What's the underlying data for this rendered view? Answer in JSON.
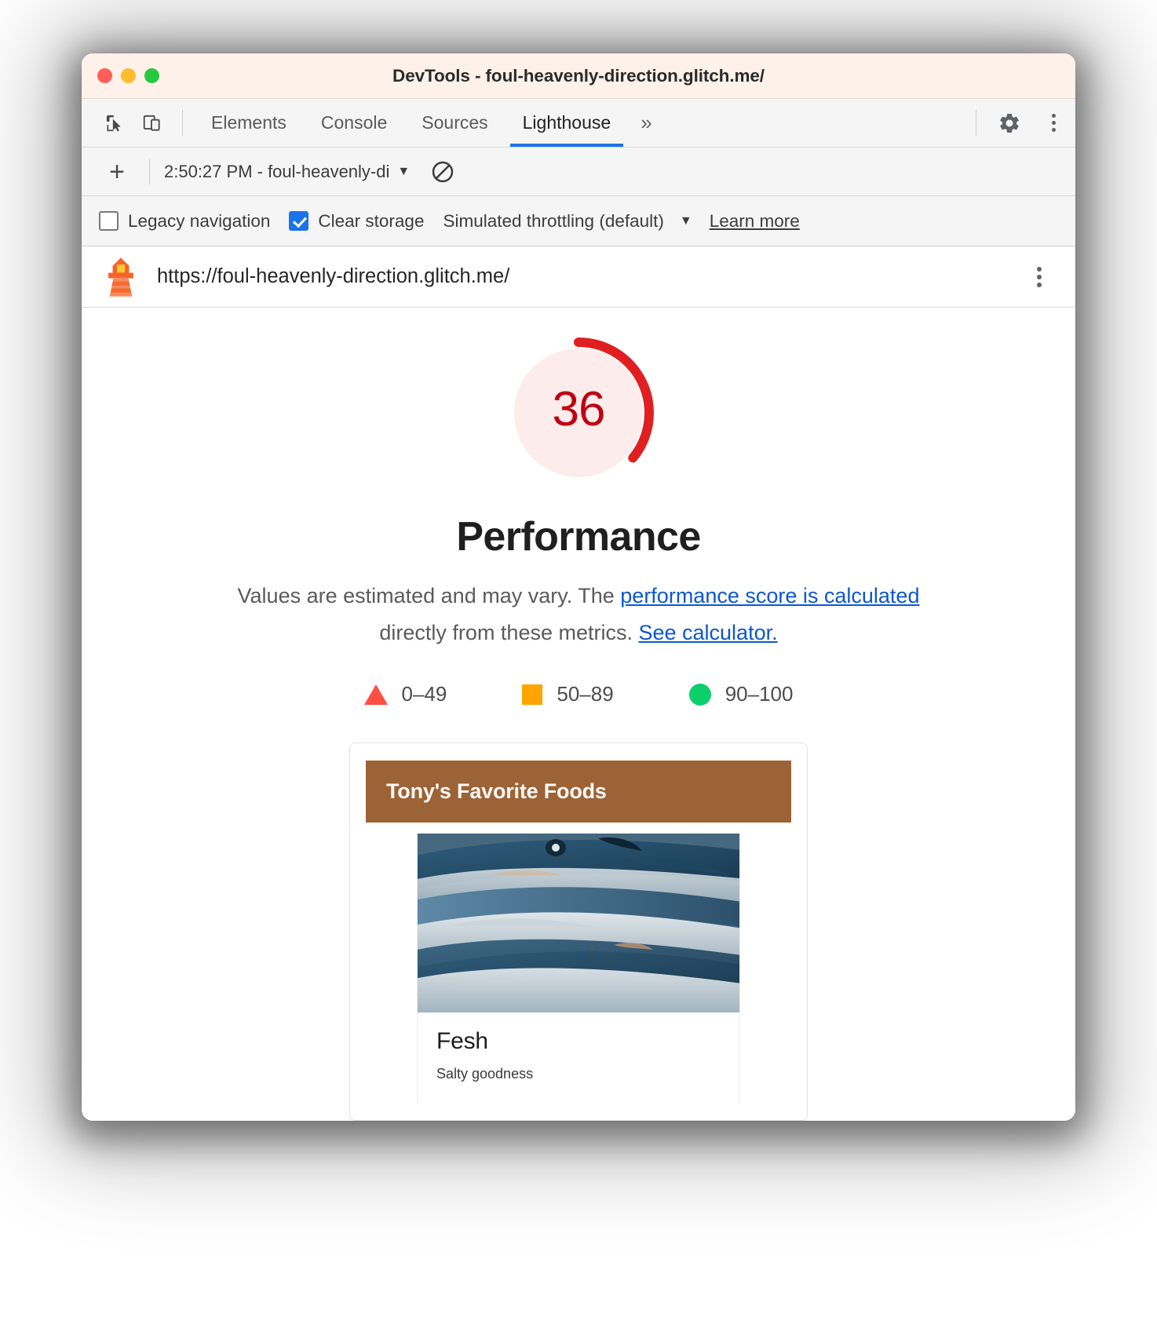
{
  "window": {
    "title": "DevTools - foul-heavenly-direction.glitch.me/"
  },
  "tabstrip": {
    "inspect_icon": "inspect-cursor-icon",
    "device_icon": "device-toolbar-icon",
    "tabs": [
      {
        "label": "Elements",
        "active": false
      },
      {
        "label": "Console",
        "active": false
      },
      {
        "label": "Sources",
        "active": false
      },
      {
        "label": "Lighthouse",
        "active": true
      }
    ],
    "more_tabs": "»",
    "settings_icon": "gear-icon",
    "menu_icon": "kebab-menu-icon"
  },
  "runbar": {
    "add_label": "+",
    "selected_run": "2:50:27 PM - foul-heavenly-di",
    "caret": "▼",
    "clear_icon": "no-entry-icon"
  },
  "options": {
    "legacy_navigation": {
      "label": "Legacy navigation",
      "checked": false
    },
    "clear_storage": {
      "label": "Clear storage",
      "checked": true
    },
    "throttling": {
      "label": "Simulated throttling (default)",
      "caret": "▼"
    },
    "learn_more": "Learn more"
  },
  "urlbar": {
    "lighthouse_icon": "lighthouse-icon",
    "url": "https://foul-heavenly-direction.glitch.me/",
    "menu_icon": "kebab-menu-icon"
  },
  "report": {
    "score": "36",
    "score_value": 36,
    "category": "Performance",
    "description_pre": "Values are estimated and may vary. The ",
    "description_link1": "performance score is calculated",
    "description_mid": " directly from these metrics. ",
    "description_link2": "See calculator.",
    "legend": [
      {
        "swatch": "triangle",
        "label": "0–49",
        "color": "#ff4e42"
      },
      {
        "swatch": "square",
        "label": "50–89",
        "color": "#ffa400"
      },
      {
        "swatch": "circle",
        "label": "90–100",
        "color": "#0cce6b"
      }
    ],
    "gauge": {
      "arc_color": "#e02020",
      "track_color": "#fdecec",
      "score_color": "#c00011"
    }
  },
  "screenshot": {
    "site_header": "Tony's Favorite Foods",
    "site_header_color": "#9c6336",
    "food_image_alt": "photo of fresh mackerel fish piled together",
    "food_title": "Fesh",
    "food_subtitle": "Salty goodness"
  }
}
